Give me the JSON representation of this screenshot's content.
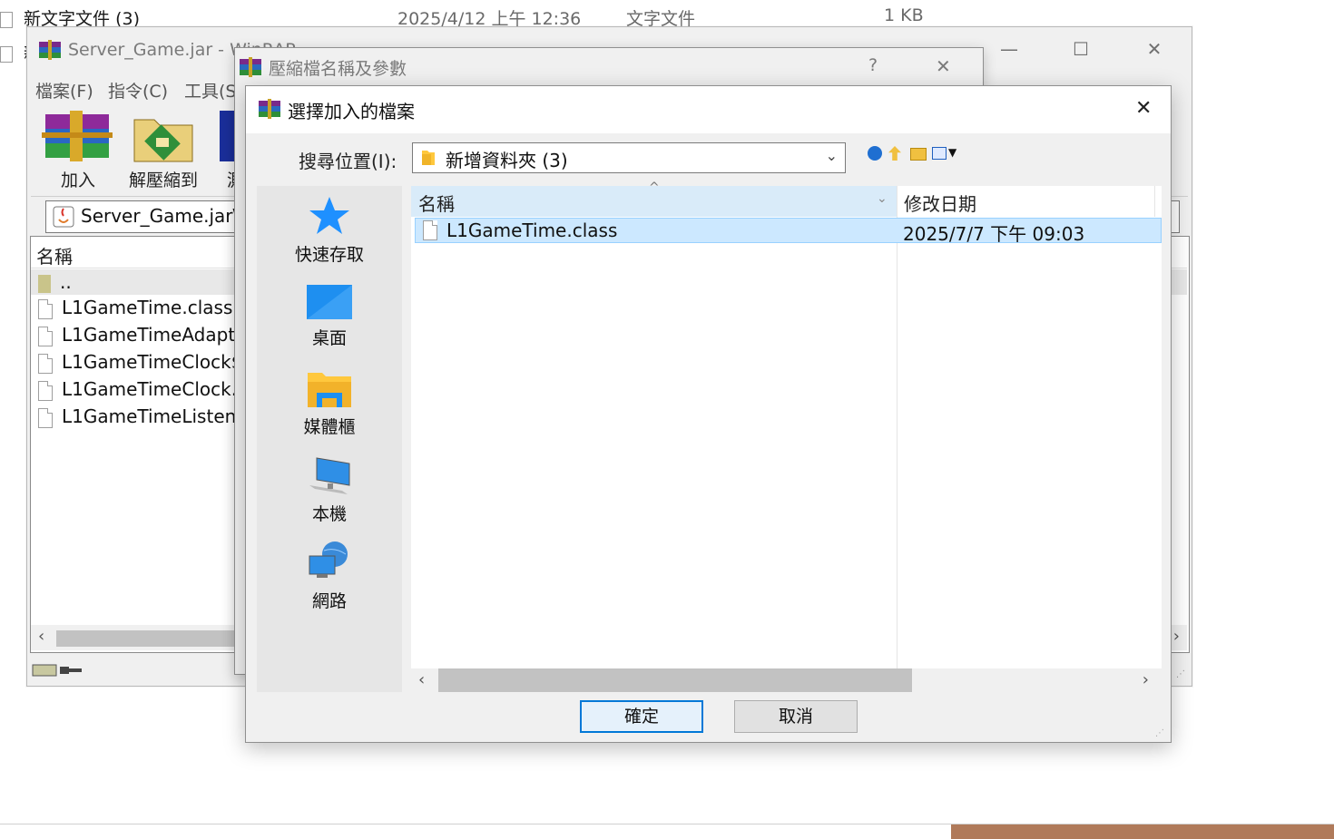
{
  "explorer": {
    "row1": {
      "name": "新文字文件 (3)",
      "date": "2025/4/12 上午 12:36",
      "type": "文字文件",
      "size": "1 KB"
    },
    "row2_prefix": "新"
  },
  "winrar": {
    "title": "Server_Game.jar - WinRAR",
    "menu": [
      "檔案(F)",
      "指令(C)",
      "工具(S"
    ],
    "toolbar": {
      "add": "加入",
      "extract": "解壓縮到",
      "test": "測"
    },
    "path": "Server_Game.jar\\",
    "list_header": "名稱",
    "files": [
      "..",
      "L1GameTime.class",
      "L1GameTimeAdapt",
      "L1GameTimeClock$",
      "L1GameTimeClock.c",
      "L1GameTimeListen"
    ]
  },
  "archive_dialog": {
    "title": "壓縮檔名稱及參數",
    "help": "?",
    "close": "✕"
  },
  "file_dialog": {
    "title": "選擇加入的檔案",
    "close": "✕",
    "look_in_label": "搜尋位置(I):",
    "look_in_value": "新增資料夾 (3)",
    "places": [
      "快速存取",
      "桌面",
      "媒體櫃",
      "本機",
      "網路"
    ],
    "columns": {
      "name": "名稱",
      "modified": "修改日期"
    },
    "files": [
      {
        "name": "L1GameTime.class",
        "modified": "2025/7/7 下午 09:03",
        "selected": true
      }
    ],
    "ok": "確定",
    "cancel": "取消"
  },
  "colors": {
    "selection": "#cce8ff",
    "accent": "#0078d7",
    "quick_access_star": "#1e90ff",
    "folder": "#ffc83d"
  }
}
